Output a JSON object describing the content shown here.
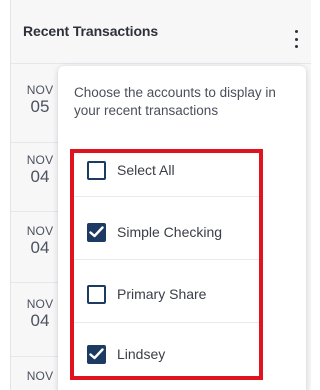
{
  "card": {
    "title": "Recent Transactions",
    "menu_icon": "kebab-menu-icon"
  },
  "dates": [
    {
      "month": "NOV",
      "day": "05"
    },
    {
      "month": "NOV",
      "day": "04"
    },
    {
      "month": "NOV",
      "day": "04"
    },
    {
      "month": "NOV",
      "day": "04"
    },
    {
      "month": "NOV",
      "day": ""
    }
  ],
  "popover": {
    "message": "Choose the accounts to display in your recent transactions",
    "options": [
      {
        "label": "Select All",
        "checked": false
      },
      {
        "label": "Simple Checking",
        "checked": true
      },
      {
        "label": "Primary Share",
        "checked": false
      },
      {
        "label": "Lindsey",
        "checked": true
      }
    ]
  },
  "colors": {
    "checkbox": "#1d3a63",
    "highlight": "#e0141e",
    "background": "#f7f7f8"
  }
}
